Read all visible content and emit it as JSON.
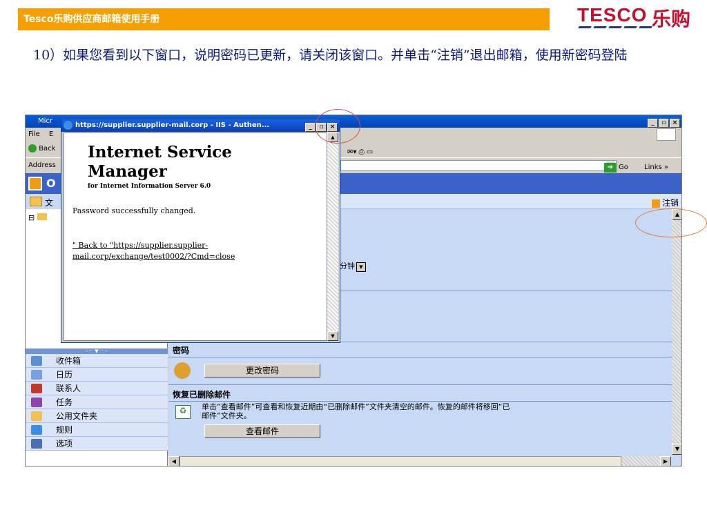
{
  "slide": {
    "header": "Tesco乐购供应商邮箱使用手册",
    "logo_brand": "TESCO",
    "logo_cn": "乐购",
    "instruction": "10）如果您看到以下窗口，说明密码已更新，请关闭该窗口。并单击“注销”退出邮箱，使用新密码登陆",
    "callout_color": "#d9534f",
    "callout_color_2": "#e07b39"
  },
  "browser": {
    "title": "Micr",
    "menu_file": "File",
    "menu_edit": "E",
    "back": "Back",
    "address_label": "Address",
    "go": "Go",
    "links": "Links »"
  },
  "owa": {
    "app_initial": "O",
    "folder_label": "文",
    "logout": "注销",
    "minutes_suffix": "分钟",
    "password_section": "密码",
    "change_password": "更改密码",
    "recover_section": "恢复已删除邮件",
    "recover_desc_line1": "单击“查看邮件”可查看和恢复近期由“已删除邮件”文件夹清空的邮件。恢复的邮件将移回“已",
    "recover_desc_line2": "邮件”文件夹。",
    "view_mail": "查看邮件",
    "splitter": "····· ▼ ·····",
    "nav": [
      {
        "label": "收件箱",
        "icon": "inbox-icon",
        "color": "#5b8fd4"
      },
      {
        "label": "日历",
        "icon": "calendar-icon",
        "color": "#7a9fe0"
      },
      {
        "label": "联系人",
        "icon": "contacts-icon",
        "color": "#c0392b"
      },
      {
        "label": "任务",
        "icon": "tasks-icon",
        "color": "#8e44ad"
      },
      {
        "label": "公用文件夹",
        "icon": "public-folders-icon",
        "color": "#f2c14e"
      },
      {
        "label": "规则",
        "icon": "rules-icon",
        "color": "#3a8ee6"
      },
      {
        "label": "选项",
        "icon": "options-icon",
        "color": "#4a6fb5"
      }
    ]
  },
  "popup": {
    "title": "https://supplier.supplier-mail.corp - IIS - Authen...",
    "heading_line1": "Internet Service",
    "heading_line2": "Manager",
    "subheading": "for Internet Information Server 6.0",
    "message": "Password successfully changed.",
    "back_link": "\" Back to \"https://supplier.supplier-mail.corp/exchange/test0002/?Cmd=close"
  }
}
